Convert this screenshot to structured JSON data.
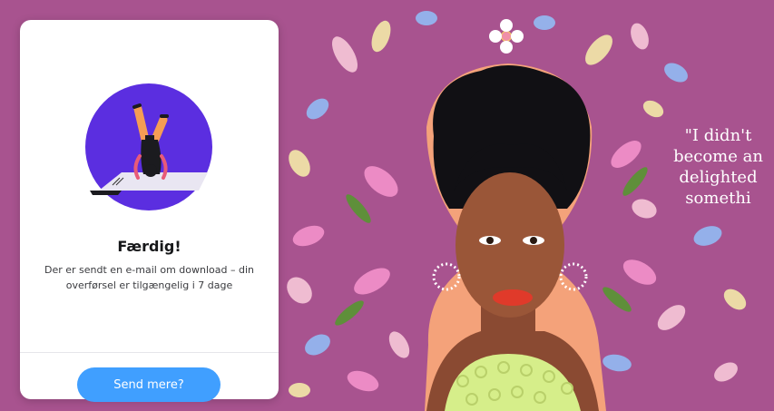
{
  "card": {
    "illustration_icon": "person-doing-headstand-icon",
    "title": "Færdig!",
    "description": "Der er sendt en e-mail om download – din overførsel er tilgængelig i 7 dage",
    "button_label": "Send mere?"
  },
  "background": {
    "quote_lines": [
      "\"I didn't",
      "become an",
      "delighted",
      "somethi"
    ]
  },
  "colors": {
    "background": "#a8538f",
    "card": "#ffffff",
    "button": "#409fff",
    "illustration_circle": "#5b2ee0"
  }
}
